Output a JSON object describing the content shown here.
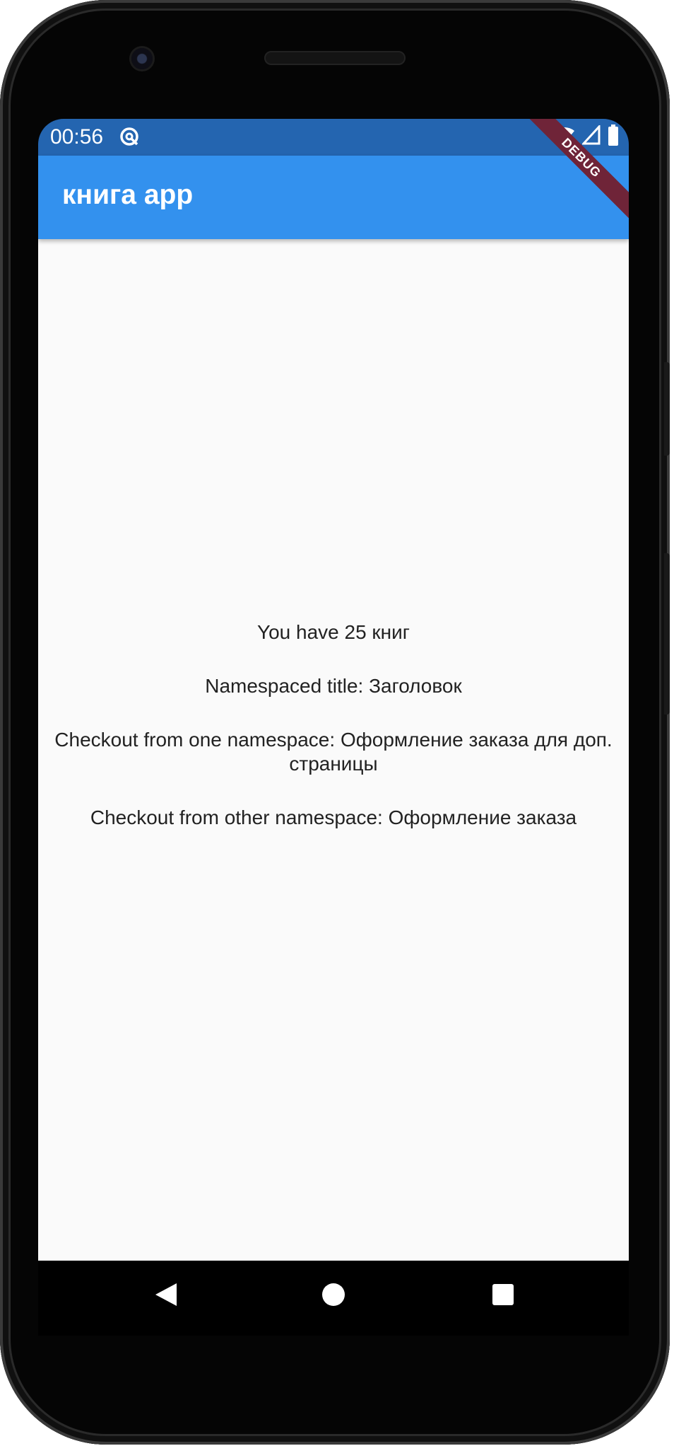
{
  "status_bar": {
    "time": "00:56",
    "icons": [
      "sync-icon",
      "wifi-icon",
      "cellular-signal-icon",
      "battery-icon"
    ]
  },
  "app_bar": {
    "title": "книга app"
  },
  "debug_banner": {
    "label": "DEBUG"
  },
  "content": {
    "lines": [
      "You have 25 книг",
      "Namespaced title: Заголовок",
      "Checkout from one namespace: Оформление заказа для доп. страницы",
      "Checkout from other namespace: Оформление заказа"
    ]
  },
  "fab": {
    "icon": "plus-icon"
  },
  "nav_bar": {
    "icons": [
      "back-icon",
      "home-icon",
      "recents-icon"
    ]
  },
  "colors": {
    "status_bar": "#2465b0",
    "app_bar": "#3391ee",
    "fab": "#3391ee",
    "debug_banner": "#6f2438",
    "background": "#fafafa",
    "text": "#222222"
  }
}
